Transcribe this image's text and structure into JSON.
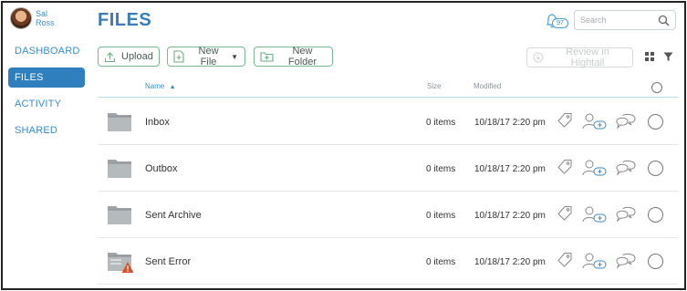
{
  "user": {
    "name": "Sal Ross",
    "first": "Sal",
    "last": "Ross"
  },
  "nav": {
    "items": [
      {
        "label": "DASHBOARD",
        "active": false
      },
      {
        "label": "FILES",
        "active": true
      },
      {
        "label": "ACTIVITY",
        "active": false
      },
      {
        "label": "SHARED",
        "active": false
      }
    ]
  },
  "header": {
    "title": "FILES",
    "notifications_count": "97",
    "search_placeholder": "Search"
  },
  "toolbar": {
    "upload_label": "Upload",
    "new_file_label": "New File",
    "new_folder_label": "New Folder",
    "review_label": "Review in Hightail"
  },
  "table": {
    "columns": {
      "name": "Name",
      "size": "Size",
      "modified": "Modified"
    },
    "sort": {
      "column": "Name",
      "direction": "ascending"
    },
    "rows": [
      {
        "name": "Inbox",
        "size": "0 items",
        "modified": "10/18/17 2:20 pm",
        "warning": false
      },
      {
        "name": "Outbox",
        "size": "0 items",
        "modified": "10/18/17 2:20 pm",
        "warning": false
      },
      {
        "name": "Sent Archive",
        "size": "0 items",
        "modified": "10/18/17 2:20 pm",
        "warning": false
      },
      {
        "name": "Sent Error",
        "size": "0 items",
        "modified": "10/18/17 2:20 pm",
        "warning": true
      }
    ]
  },
  "colors": {
    "accent": "#3a7bb8",
    "nav_active_bg": "#2f7fbf",
    "button_border": "#79b891",
    "warning": "#d9532c"
  },
  "icons": {
    "upload": "upload-icon",
    "new_file": "new-file-icon",
    "new_folder": "new-folder-icon",
    "bell": "bell-icon",
    "search": "search-icon",
    "grid": "grid-view-icon",
    "filter": "filter-icon",
    "folder": "folder-icon",
    "tag": "tag-icon",
    "share": "share-user-icon",
    "comment": "comment-icon",
    "warning": "warning-icon"
  }
}
